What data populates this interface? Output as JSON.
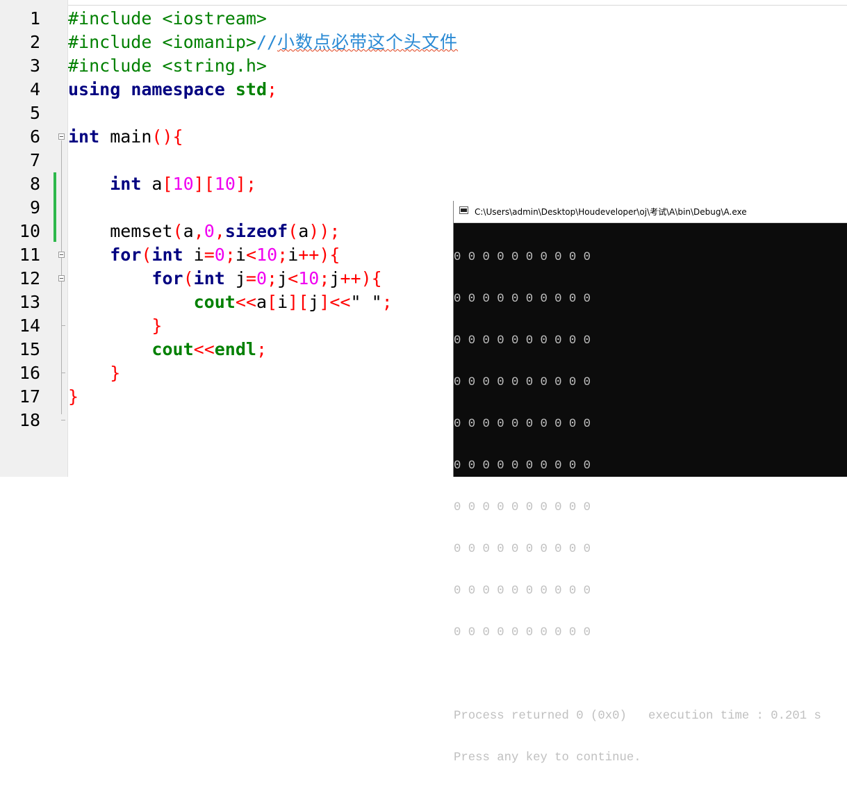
{
  "editor": {
    "line_numbers": [
      "1",
      "2",
      "3",
      "4",
      "5",
      "6",
      "7",
      "8",
      "9",
      "10",
      "11",
      "12",
      "13",
      "14",
      "15",
      "16",
      "17",
      "18"
    ],
    "lines": {
      "l1": {
        "directive": "#include",
        "arg": " <iostream>"
      },
      "l2": {
        "directive": "#include",
        "arg": " <iomanip>",
        "comment_prefix": "//",
        "comment_text": "小数点必带这个头文件"
      },
      "l3": {
        "directive": "#include",
        "arg": " <string.h>"
      },
      "l4": {
        "kw_using": "using",
        "kw_namespace": "namespace",
        "ns": "std",
        "semi": ";"
      },
      "l6": {
        "type": "int",
        "name": " main",
        "paren": "()",
        "brace": "{"
      },
      "l8": {
        "type": "int",
        "var": " a",
        "lb1": "[",
        "n1": "10",
        "rb1": "]",
        "lb2": "[",
        "n2": "10",
        "rb2": "]",
        "semi": ";"
      },
      "l10": {
        "fn": "memset",
        "lp": "(",
        "a": "a",
        "c1": ",",
        "zero": "0",
        "c2": ",",
        "sizeof": "sizeof",
        "lp2": "(",
        "a2": "a",
        "rp": "))",
        "semi": ";"
      },
      "l11": {
        "for": "for",
        "lp": "(",
        "type": "int",
        "i": " i",
        "eq": "=",
        "zero": "0",
        "s1": ";",
        "i2": "i",
        "lt": "<",
        "ten": "10",
        "s2": ";",
        "i3": "i",
        "inc": "++",
        "rp": ")",
        "brace": "{"
      },
      "l12": {
        "for": "for",
        "lp": "(",
        "type": "int",
        "j": " j",
        "eq": "=",
        "zero": "0",
        "s1": ";",
        "j2": "j",
        "lt": "<",
        "ten": "10",
        "s2": ";",
        "j3": "j",
        "inc": "++",
        "rp": ")",
        "brace": "{"
      },
      "l13": {
        "cout": "cout",
        "shl": "<<",
        "a": "a",
        "lb1": "[",
        "i": "i",
        "rb1": "][",
        "j": "j",
        "rb2": "]",
        "shl2": "<<",
        "str": "\" \"",
        "semi": ";"
      },
      "l14": {
        "brace": "}"
      },
      "l15": {
        "cout": "cout",
        "shl": "<<",
        "endl": "endl",
        "semi": ";"
      },
      "l16": {
        "brace": "}"
      },
      "l17": {
        "brace": "}"
      }
    }
  },
  "console": {
    "title": "C:\\Users\\admin\\Desktop\\Houdeveloper\\oj\\考试\\A\\bin\\Debug\\A.exe",
    "output_rows": [
      "0 0 0 0 0 0 0 0 0 0",
      "0 0 0 0 0 0 0 0 0 0",
      "0 0 0 0 0 0 0 0 0 0",
      "0 0 0 0 0 0 0 0 0 0",
      "0 0 0 0 0 0 0 0 0 0",
      "0 0 0 0 0 0 0 0 0 0",
      "0 0 0 0 0 0 0 0 0 0",
      "0 0 0 0 0 0 0 0 0 0",
      "0 0 0 0 0 0 0 0 0 0",
      "0 0 0 0 0 0 0 0 0 0"
    ],
    "blank": "",
    "process_line": "Process returned 0 (0x0)   execution time : 0.201 s",
    "continue_line": "Press any key to continue."
  },
  "colors": {
    "keyword": "#000080",
    "preprocessor": "#008000",
    "number": "#f000f0",
    "operator": "#ff0000",
    "comment": "#2a8ad4",
    "change_bar": "#2db84b",
    "console_bg": "#0c0c0c",
    "console_fg": "#c0c0c0"
  },
  "icons": [
    "fold-minus-icon",
    "console-window-icon"
  ]
}
